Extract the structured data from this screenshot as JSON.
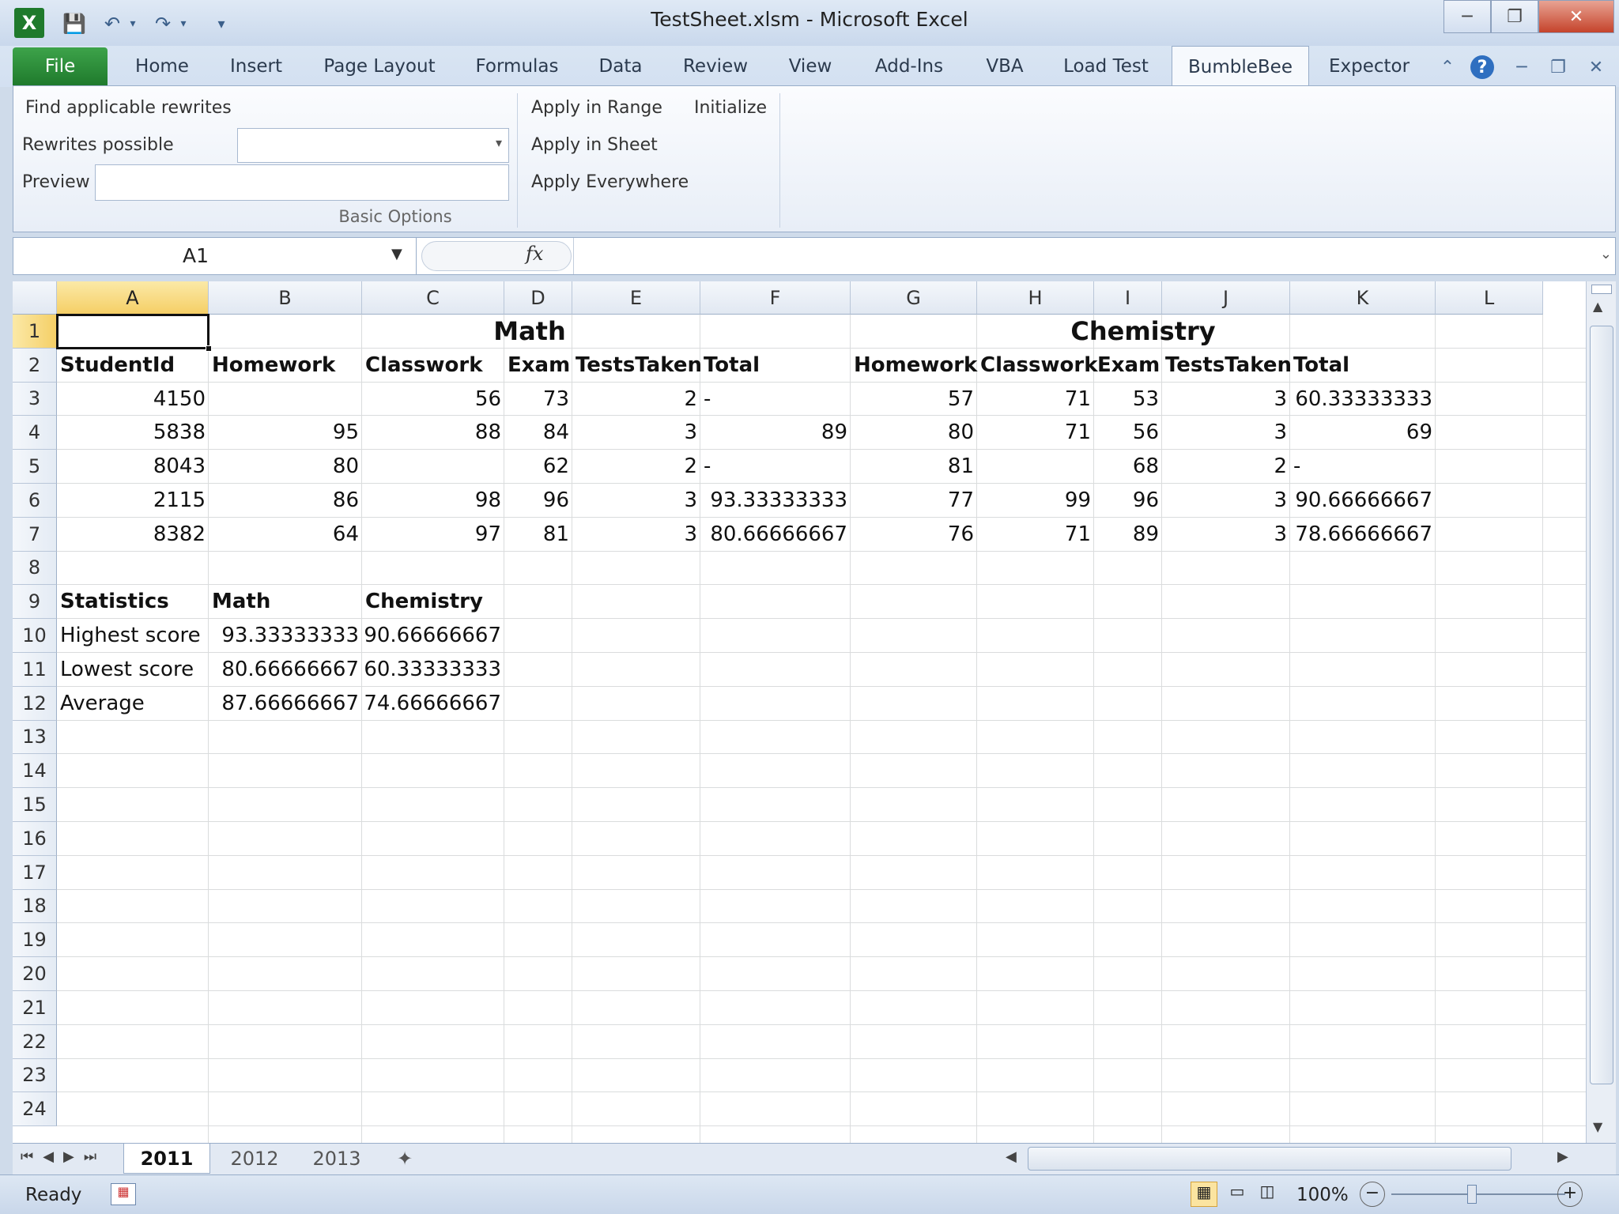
{
  "window": {
    "title": "TestSheet.xlsm  -  Microsoft Excel"
  },
  "tabs": {
    "file": "File",
    "items": [
      "Home",
      "Insert",
      "Page Layout",
      "Formulas",
      "Data",
      "Review",
      "View",
      "Add-Ins",
      "VBA",
      "Load Test",
      "BumbleBee",
      "Expector"
    ],
    "active": "BumbleBee"
  },
  "ribbon": {
    "find_rewrites": "Find applicable rewrites",
    "rewrites_label": "Rewrites possible",
    "rewrites_value": "",
    "preview_label": "Preview",
    "preview_value": "",
    "group_label": "Basic Options",
    "apply_range": "Apply in Range",
    "apply_sheet": "Apply in Sheet",
    "apply_everywhere": "Apply Everywhere",
    "initialize": "Initialize"
  },
  "formula_bar": {
    "name_box": "A1",
    "fx": "fx",
    "formula": ""
  },
  "sheet": {
    "columns": [
      "A",
      "B",
      "C",
      "D",
      "E",
      "F",
      "G",
      "H",
      "I",
      "J",
      "K",
      "L"
    ],
    "selected_column": "A",
    "selected_row": "1",
    "rows": [
      "1",
      "2",
      "3",
      "4",
      "5",
      "6",
      "7",
      "8",
      "9",
      "10",
      "11",
      "12",
      "13",
      "14",
      "15",
      "16",
      "17",
      "18",
      "19",
      "20",
      "21",
      "22",
      "23",
      "24"
    ],
    "headers": {
      "math": "Math",
      "chemistry": "Chemistry",
      "row2": [
        "StudentId",
        "Homework",
        "Classwork",
        "Exam",
        "TestsTaken",
        "Total",
        "Homework",
        "Classwork",
        "Exam",
        "TestsTaken",
        "Total"
      ]
    },
    "data": [
      [
        "4150",
        "",
        "56",
        "73",
        "2",
        "-",
        "57",
        "71",
        "53",
        "3",
        "60.33333333"
      ],
      [
        "5838",
        "95",
        "88",
        "84",
        "3",
        "89",
        "80",
        "71",
        "56",
        "3",
        "69"
      ],
      [
        "8043",
        "80",
        "",
        "62",
        "2",
        "-",
        "81",
        "",
        "68",
        "2",
        "-"
      ],
      [
        "2115",
        "86",
        "98",
        "96",
        "3",
        "93.33333333",
        "77",
        "99",
        "96",
        "3",
        "90.66666667"
      ],
      [
        "8382",
        "64",
        "97",
        "81",
        "3",
        "80.66666667",
        "76",
        "71",
        "89",
        "3",
        "78.66666667"
      ]
    ],
    "stats_header": [
      "Statistics",
      "Math",
      "Chemistry"
    ],
    "stats": [
      [
        "Highest score",
        "93.33333333",
        "90.66666667"
      ],
      [
        "Lowest score",
        "80.66666667",
        "60.33333333"
      ],
      [
        "Average",
        "87.66666667",
        "74.66666667"
      ]
    ]
  },
  "sheet_tabs": [
    "2011",
    "2012",
    "2013"
  ],
  "active_sheet": "2011",
  "status": {
    "ready": "Ready",
    "zoom": "100%"
  },
  "icons": [
    "excel-logo-icon",
    "save-icon",
    "undo-icon",
    "redo-icon",
    "customize-icon",
    "minimize-icon",
    "restore-icon",
    "close-icon",
    "help-icon",
    "expand-icon",
    "dropdown-icon",
    "new-sheet-icon",
    "normal-view-icon",
    "page-layout-icon",
    "page-break-icon",
    "zoom-out-icon",
    "zoom-in-icon"
  ]
}
